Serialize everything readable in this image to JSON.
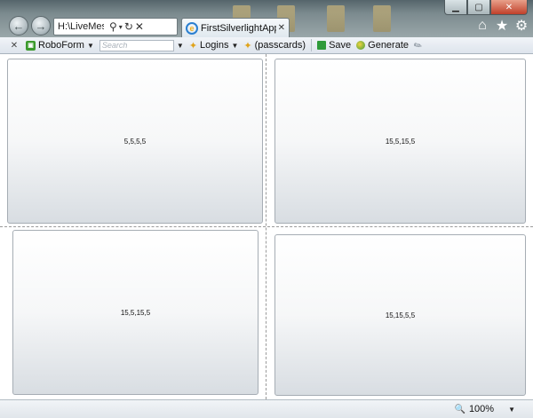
{
  "browser": {
    "address_text": "H:\\LiveMesh\\M",
    "tab_title": "FirstSilverlightAppli...",
    "icons": [
      "back-arrow-icon",
      "forward-arrow-icon",
      "search-icon",
      "refresh-icon",
      "close-icon",
      "ie-icon",
      "home-icon",
      "star-icon",
      "gear-icon"
    ]
  },
  "roboform": {
    "name": "RoboForm",
    "search_placeholder": "Search",
    "logins": "Logins",
    "passcards": "(passcards)",
    "save": "Save",
    "generate": "Generate"
  },
  "panels": [
    {
      "label": "5,5,5,5"
    },
    {
      "label": "15,5,15,5"
    },
    {
      "label": "15,5,15,5"
    },
    {
      "label": "15,15,5,5"
    }
  ],
  "status": {
    "zoom": "100%"
  }
}
